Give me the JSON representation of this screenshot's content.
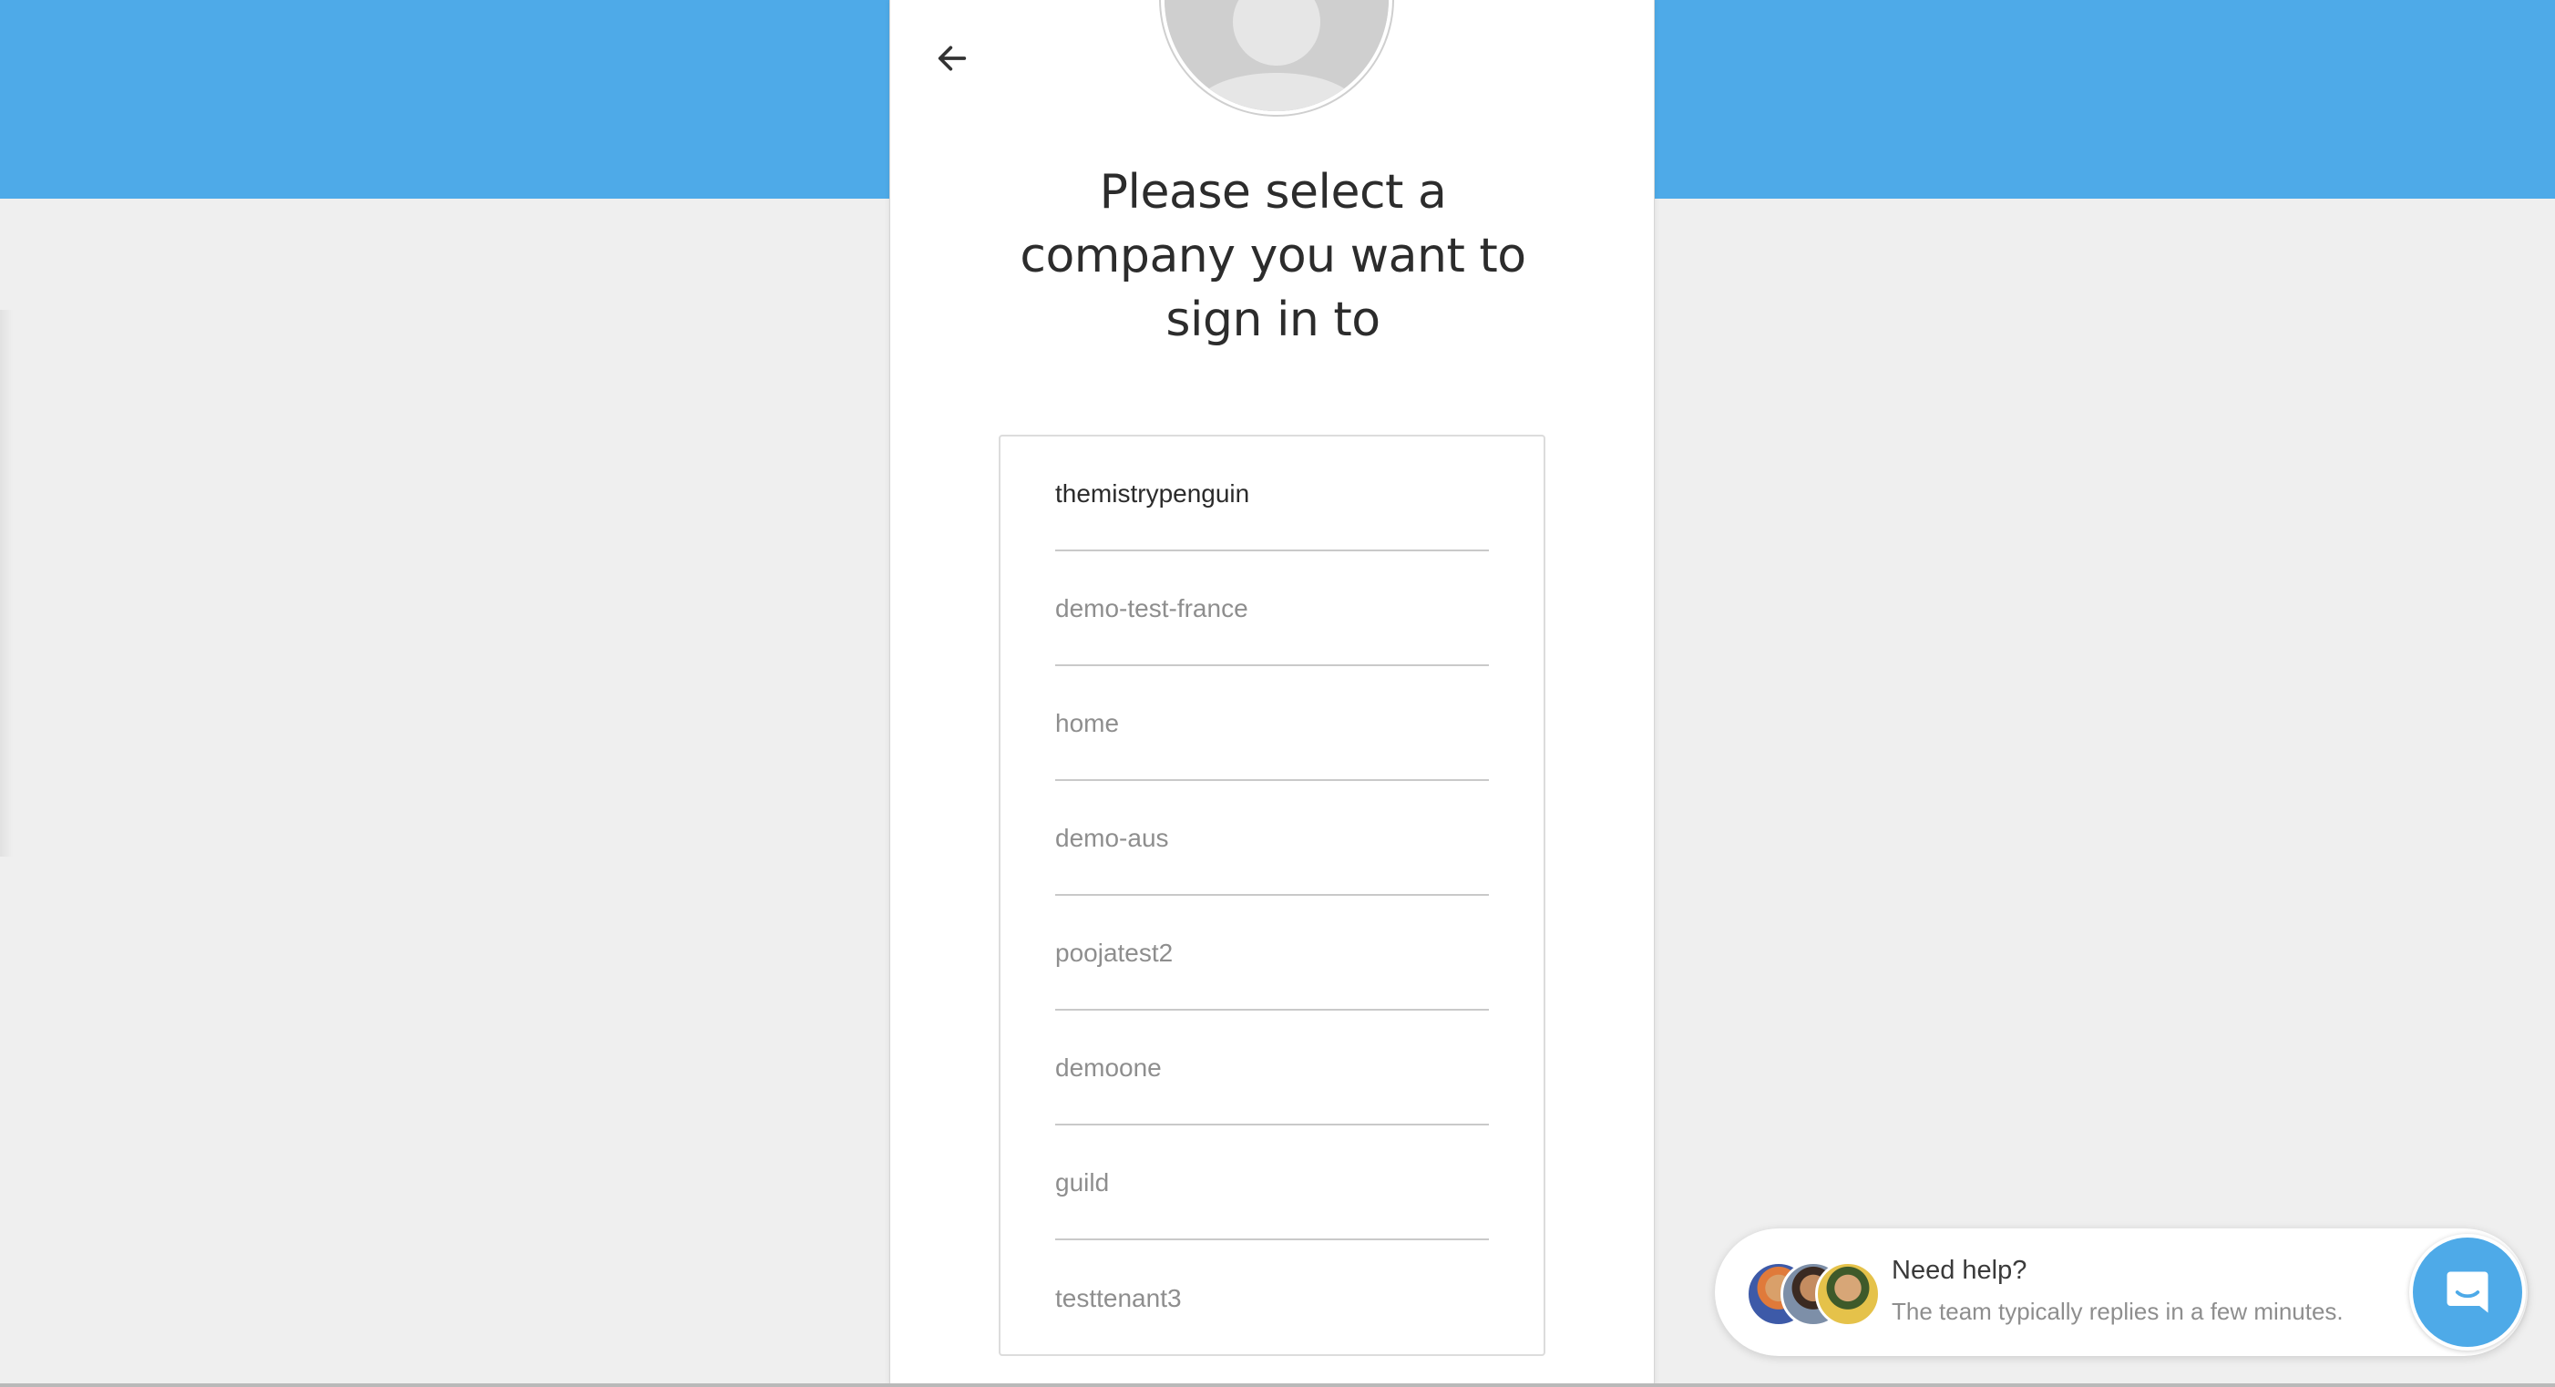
{
  "header": {
    "title_line1": "Please select a",
    "title_line2": "company you want to",
    "title_line3": "sign in to"
  },
  "companies": [
    "themistrypenguin",
    "demo-test-france",
    "home",
    "demo-aus",
    "poojatest2",
    "demoone",
    "guild",
    "testtenant3"
  ],
  "help": {
    "title": "Need help?",
    "subtitle": "The team typically replies in a few minutes."
  },
  "icons": {
    "back": "arrow-left-icon",
    "avatar": "user-placeholder-avatar",
    "chat": "chat-bubble-icon"
  },
  "colors": {
    "brand_blue": "#4eaae8",
    "background": "#efefef"
  }
}
